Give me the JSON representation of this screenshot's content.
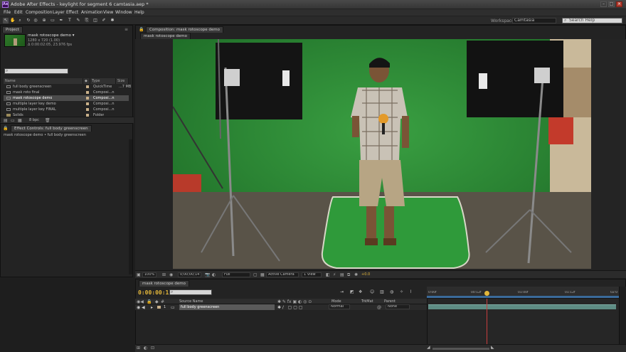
{
  "app": {
    "logo": "Ae",
    "window_title": "Adobe After Effects - keylight for segment 6 camtasia.aep *"
  },
  "menu": [
    "File",
    "Edit",
    "Composition",
    "Layer",
    "Effect",
    "Animation",
    "View",
    "Window",
    "Help"
  ],
  "toolbar": {
    "workspace_label": "Workspace:",
    "workspace_value": "Camtasia",
    "search_placeholder": "Search Help"
  },
  "project_panel": {
    "tab": "Project",
    "selected_name": "mask rotoscope demo ▾",
    "selected_info_1": "1280 x 720 (1.00)",
    "selected_info_2": "Δ 0:00:02:05, 23.976 fps",
    "columns": {
      "name": "Name",
      "type": "Type",
      "size": "Size"
    },
    "items": [
      {
        "name": "full body greenscreen",
        "type": "QuickTime",
        "size": "...7 MB",
        "tag": "#c9b08a",
        "selected": false
      },
      {
        "name": "mask roto final",
        "type": "Composi...n",
        "size": "",
        "tag": "#c9b08a",
        "selected": false
      },
      {
        "name": "mask rotoscope demo",
        "type": "Composi...n",
        "size": "",
        "tag": "#c9b08a",
        "selected": true
      },
      {
        "name": "multiple layer key demo",
        "type": "Composi...n",
        "size": "",
        "tag": "#c9b08a",
        "selected": false
      },
      {
        "name": "multiple layer key FINAL",
        "type": "Composi...n",
        "size": "",
        "tag": "#c9b08a",
        "selected": false
      },
      {
        "name": "Solids",
        "type": "Folder",
        "size": "",
        "tag": "#c9b08a",
        "selected": false
      }
    ],
    "footer_bpc": "8 bpc"
  },
  "effect_controls": {
    "tab": "Effect Controls: full body greenscreen",
    "path": "mask rotoscope demo • full body greenscreen"
  },
  "composition": {
    "tab": "Composition: mask rotoscope demo",
    "sub_tab": "mask rotoscope demo",
    "controls": {
      "zoom": "100%",
      "time": "0;00;00;14",
      "resolution": "Full",
      "camera": "Active Camera",
      "views": "1 View",
      "exposure": "+0.0"
    }
  },
  "timeline": {
    "tab": "mask rotoscope demo",
    "timecode": "0:00:00:15",
    "columns": {
      "source_name": "Source Name",
      "mode": "Mode",
      "trkmat": "TrkMat",
      "parent": "Parent"
    },
    "layer": {
      "number": "1",
      "name": "full body greenscreen",
      "mode": "Normal",
      "parent": "None"
    },
    "ruler": [
      "0:00f",
      "00:12f",
      "01:00f",
      "01:12f",
      "02:0"
    ]
  },
  "colors": {
    "timecode": "#e3b73b",
    "layer_bar": "#5e8c84",
    "playhead": "#c83d3d",
    "greenscreen": "#2f8a35"
  }
}
